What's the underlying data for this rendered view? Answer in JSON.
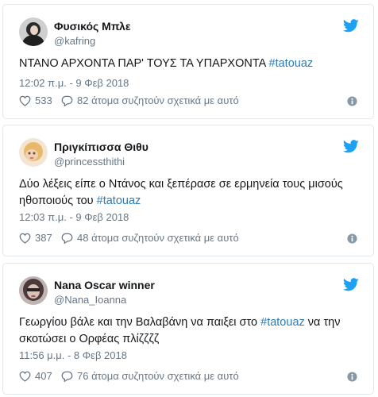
{
  "tweets": [
    {
      "name": "Φυσικός Μπλε",
      "handle": "@kafring",
      "text_before": "ΝΤΑΝΟ ΑΡΧΟΝΤΑ ΠΑΡ' ΤΟΥΣ ΤΑ ΥΠΑΡΧΟΝΤΑ ",
      "hashtag": "#tatouaz",
      "text_after": "",
      "timestamp": "12:02 π.μ. - 9 Φεβ 2018",
      "likes": "533",
      "replies": "82 άτομα συζητούν σχετικά με αυτό"
    },
    {
      "name": "Πριγκίπισσα Θιθυ",
      "handle": "@princessthithi",
      "text_before": "Δύο λέξεις είπε ο Ντάνος και ξεπέρασε σε ερμηνεία τους μισούς ηθοποιούς του ",
      "hashtag": "#tatouaz",
      "text_after": "",
      "timestamp": "12:03 π.μ. - 9 Φεβ 2018",
      "likes": "387",
      "replies": "48 άτομα συζητούν σχετικά με αυτό"
    },
    {
      "name": "Nana Oscar winner",
      "handle": "@Nana_Ioanna",
      "text_before": "Γεωργίου βάλε και την Βαλαβάνη να παιξει στο ",
      "hashtag": "#tatouaz",
      "text_after": " να την σκοτώσει ο Ορφέας πλίζζζζ",
      "timestamp": "11:56 μ.μ. - 8 Φεβ 2018",
      "likes": "407",
      "replies": "76 άτομα συζητούν σχετικά με αυτό"
    }
  ],
  "colors": {
    "twitter_blue": "#1da1f2",
    "link": "#2b7bb9",
    "secondary": "#657786",
    "border": "#e1e8ed"
  },
  "icons": [
    "twitter-bird-icon",
    "heart-icon",
    "reply-bubble-icon",
    "info-icon"
  ]
}
